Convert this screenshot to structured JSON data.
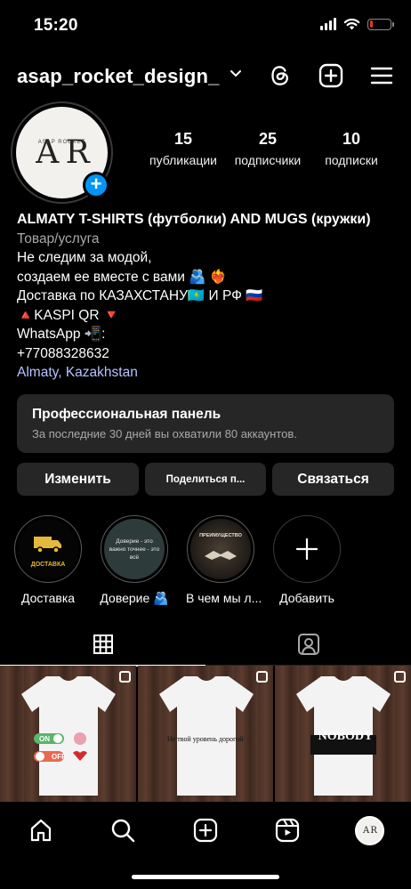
{
  "status_bar": {
    "time": "15:20",
    "battery_percent": 15,
    "battery_color": "#e0352b"
  },
  "header": {
    "username": "asap_rocket_design_"
  },
  "profile": {
    "avatar_text": "A R",
    "avatar_subtext": "ASAP ROCKET",
    "stats": [
      {
        "value": "15",
        "label": "публикации"
      },
      {
        "value": "25",
        "label": "подписчики"
      },
      {
        "value": "10",
        "label": "подписки"
      }
    ]
  },
  "bio": {
    "name": "ALMATY T-SHIRTS (футболки) AND MUGS (кружки)",
    "category": "Товар/услуга",
    "lines": [
      "Не следим за модой,",
      "создаем ее вместе с вами 🫂 ❤️‍🔥",
      "Доставка по КАЗАХСТАНУ🇰🇿 И РФ 🇷🇺",
      "🔺KASPI QR 🔻",
      "WhatsApp 📲:",
      "+77088328632"
    ],
    "location": "Almaty, Kazakhstan"
  },
  "panel": {
    "title": "Профессиональная панель",
    "subtitle": "За последние 30 дней вы охватили 80 аккаунтов."
  },
  "buttons": {
    "edit": "Изменить",
    "share": "Поделиться п...",
    "contact": "Связаться"
  },
  "highlights": [
    {
      "label": "Доставка",
      "cover_text": "ДОСТАВКА"
    },
    {
      "label": "Доверие 🫂",
      "cover_text": "Доверие - это важно точнее - это всё"
    },
    {
      "label": "В чем мы л...",
      "cover_text": "ПРЕИМУЩЕСТВО"
    },
    {
      "label": "Добавить"
    }
  ],
  "posts": [
    {
      "toggle_on": "ON",
      "toggle_off": "OFF"
    },
    {
      "text": "Не твой уровень дорогой"
    },
    {
      "text": "NOBODY"
    }
  ],
  "nav": {
    "profile_avatar_text": "A R"
  },
  "colors": {
    "accent": "#0095f6",
    "link": "#b7c3ff",
    "surface": "#262626"
  }
}
